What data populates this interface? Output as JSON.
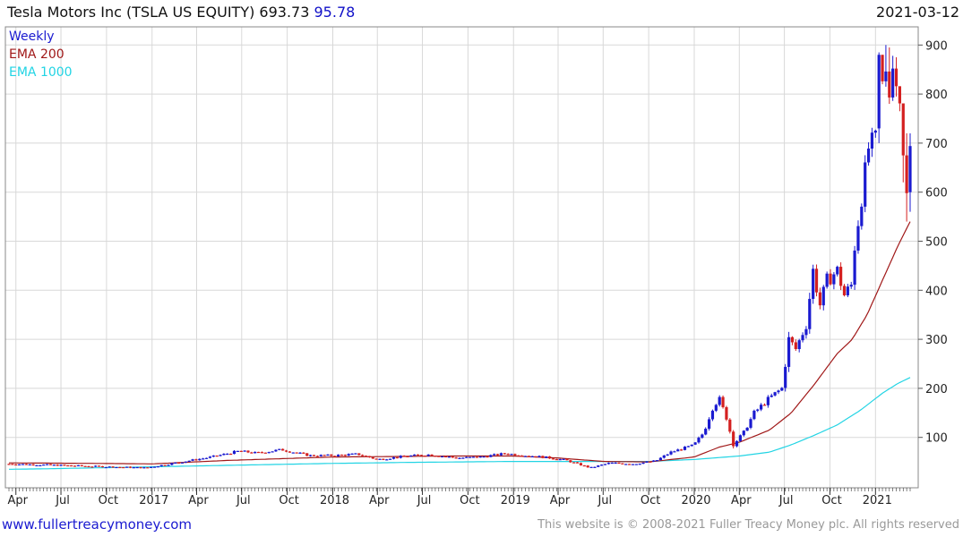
{
  "header": {
    "title": "Tesla Motors Inc (TSLA US EQUITY)",
    "last_price": "693.73",
    "change": "95.78",
    "date": "2021-03-12"
  },
  "footer": {
    "site": "www.fullertreacymoney.com",
    "copyright": "This website is © 2008-2021 Fuller Treacy Money plc. All rights reserved"
  },
  "colors": {
    "up": "#1a1ad0",
    "down": "#d42020",
    "ema200": "#a01818",
    "ema1000": "#22d4e4",
    "grid": "#d8d8d8",
    "week_tick": "#333333"
  },
  "chart_data": {
    "type": "candlestick",
    "frequency_label": "Weekly",
    "legend": [
      {
        "label": "Weekly",
        "color": "#1a1ad0"
      },
      {
        "label": "EMA 200",
        "color": "#a01818"
      },
      {
        "label": "EMA 1000",
        "color": "#22d4e4"
      }
    ],
    "legend_position": "top-left",
    "y_axis": {
      "side": "right",
      "ylim": [
        0,
        920
      ],
      "ticks": [
        100,
        200,
        300,
        400,
        500,
        600,
        700,
        800,
        900
      ]
    },
    "x_axis": {
      "xlim": [
        "2016-03-18",
        "2021-03-12"
      ],
      "ticks": [
        {
          "label": "Apr",
          "date": "2016-04-01"
        },
        {
          "label": "Jul",
          "date": "2016-07-01"
        },
        {
          "label": "Oct",
          "date": "2016-10-01"
        },
        {
          "label": "2017",
          "date": "2017-01-01"
        },
        {
          "label": "Apr",
          "date": "2017-04-01"
        },
        {
          "label": "Jul",
          "date": "2017-07-01"
        },
        {
          "label": "Oct",
          "date": "2017-10-01"
        },
        {
          "label": "2018",
          "date": "2018-01-01"
        },
        {
          "label": "Apr",
          "date": "2018-04-01"
        },
        {
          "label": "Jul",
          "date": "2018-07-01"
        },
        {
          "label": "Oct",
          "date": "2018-10-01"
        },
        {
          "label": "2019",
          "date": "2019-01-01"
        },
        {
          "label": "Apr",
          "date": "2019-04-01"
        },
        {
          "label": "Jul",
          "date": "2019-07-01"
        },
        {
          "label": "Oct",
          "date": "2019-10-01"
        },
        {
          "label": "2020",
          "date": "2020-01-01"
        },
        {
          "label": "Apr",
          "date": "2020-04-01"
        },
        {
          "label": "Jul",
          "date": "2020-07-01"
        },
        {
          "label": "Oct",
          "date": "2020-10-01"
        },
        {
          "label": "2021",
          "date": "2021-01-01"
        }
      ]
    },
    "grid": true,
    "close_keypoints": [
      [
        "2016-03-18",
        46
      ],
      [
        "2016-06-01",
        44
      ],
      [
        "2016-09-01",
        41
      ],
      [
        "2016-12-20",
        38
      ],
      [
        "2017-03-01",
        50
      ],
      [
        "2017-05-01",
        60
      ],
      [
        "2017-06-25",
        72
      ],
      [
        "2017-08-01",
        68
      ],
      [
        "2017-09-20",
        75
      ],
      [
        "2017-11-15",
        63
      ],
      [
        "2018-01-01",
        63
      ],
      [
        "2018-02-20",
        66
      ],
      [
        "2018-04-01",
        55
      ],
      [
        "2018-06-01",
        62
      ],
      [
        "2018-07-15",
        65
      ],
      [
        "2018-09-10",
        58
      ],
      [
        "2018-10-25",
        60
      ],
      [
        "2018-12-15",
        67
      ],
      [
        "2019-03-01",
        60
      ],
      [
        "2019-04-15",
        54
      ],
      [
        "2019-06-05",
        38
      ],
      [
        "2019-07-15",
        48
      ],
      [
        "2019-09-01",
        46
      ],
      [
        "2019-10-15",
        52
      ],
      [
        "2019-11-15",
        70
      ],
      [
        "2019-12-31",
        84
      ],
      [
        "2020-01-20",
        110
      ],
      [
        "2020-02-07",
        160
      ],
      [
        "2020-02-20",
        180
      ],
      [
        "2020-03-06",
        140
      ],
      [
        "2020-03-20",
        85
      ],
      [
        "2020-04-10",
        110
      ],
      [
        "2020-05-01",
        150
      ],
      [
        "2020-06-01",
        180
      ],
      [
        "2020-06-26",
        200
      ],
      [
        "2020-07-10",
        300
      ],
      [
        "2020-07-24",
        280
      ],
      [
        "2020-08-14",
        330
      ],
      [
        "2020-08-28",
        440
      ],
      [
        "2020-09-11",
        370
      ],
      [
        "2020-09-25",
        420
      ],
      [
        "2020-10-16",
        440
      ],
      [
        "2020-10-30",
        390
      ],
      [
        "2020-11-13",
        410
      ],
      [
        "2020-11-20",
        490
      ],
      [
        "2020-12-04",
        590
      ],
      [
        "2020-12-18",
        690
      ],
      [
        "2021-01-01",
        705
      ],
      [
        "2021-01-08",
        880
      ],
      [
        "2021-01-22",
        846
      ],
      [
        "2021-02-05",
        852
      ],
      [
        "2021-02-19",
        781
      ],
      [
        "2021-02-26",
        675
      ],
      [
        "2021-03-05",
        598
      ],
      [
        "2021-03-12",
        694
      ]
    ],
    "ema200_keypoints": [
      [
        "2016-03-18",
        48
      ],
      [
        "2016-09-01",
        47
      ],
      [
        "2017-01-01",
        46
      ],
      [
        "2017-06-01",
        53
      ],
      [
        "2018-01-01",
        60
      ],
      [
        "2018-09-01",
        62
      ],
      [
        "2019-01-01",
        62
      ],
      [
        "2019-04-01",
        58
      ],
      [
        "2019-07-01",
        51
      ],
      [
        "2019-10-01",
        50
      ],
      [
        "2020-01-01",
        60
      ],
      [
        "2020-02-20",
        80
      ],
      [
        "2020-04-01",
        90
      ],
      [
        "2020-06-01",
        115
      ],
      [
        "2020-07-15",
        150
      ],
      [
        "2020-09-01",
        210
      ],
      [
        "2020-10-15",
        270
      ],
      [
        "2020-11-15",
        300
      ],
      [
        "2020-12-15",
        350
      ],
      [
        "2021-01-15",
        420
      ],
      [
        "2021-02-15",
        490
      ],
      [
        "2021-03-12",
        540
      ]
    ],
    "ema1000_keypoints": [
      [
        "2016-03-18",
        35
      ],
      [
        "2016-06-01",
        36
      ],
      [
        "2017-01-01",
        40
      ],
      [
        "2017-06-01",
        43
      ],
      [
        "2018-01-01",
        47
      ],
      [
        "2018-06-01",
        49
      ],
      [
        "2019-01-01",
        51
      ],
      [
        "2019-06-01",
        51
      ],
      [
        "2019-10-01",
        51
      ],
      [
        "2020-01-01",
        55
      ],
      [
        "2020-04-01",
        62
      ],
      [
        "2020-06-01",
        70
      ],
      [
        "2020-07-15",
        85
      ],
      [
        "2020-09-01",
        105
      ],
      [
        "2020-10-15",
        125
      ],
      [
        "2020-12-01",
        155
      ],
      [
        "2021-01-15",
        190
      ],
      [
        "2021-02-15",
        210
      ],
      [
        "2021-03-12",
        222
      ]
    ],
    "last_candles": [
      {
        "date": "2021-01-08",
        "open": 730,
        "high": 885,
        "low": 700,
        "close": 880
      },
      {
        "date": "2021-01-15",
        "open": 880,
        "high": 880,
        "low": 820,
        "close": 826
      },
      {
        "date": "2021-01-22",
        "open": 826,
        "high": 900,
        "low": 815,
        "close": 846
      },
      {
        "date": "2021-01-29",
        "open": 846,
        "high": 895,
        "low": 780,
        "close": 793
      },
      {
        "date": "2021-02-05",
        "open": 793,
        "high": 878,
        "low": 786,
        "close": 852
      },
      {
        "date": "2021-02-12",
        "open": 852,
        "high": 875,
        "low": 795,
        "close": 816
      },
      {
        "date": "2021-02-19",
        "open": 816,
        "high": 815,
        "low": 765,
        "close": 781
      },
      {
        "date": "2021-02-26",
        "open": 781,
        "high": 768,
        "low": 620,
        "close": 675
      },
      {
        "date": "2021-03-05",
        "open": 675,
        "high": 720,
        "low": 540,
        "close": 598
      },
      {
        "date": "2021-03-12",
        "open": 600,
        "high": 720,
        "low": 560,
        "close": 694
      }
    ]
  }
}
